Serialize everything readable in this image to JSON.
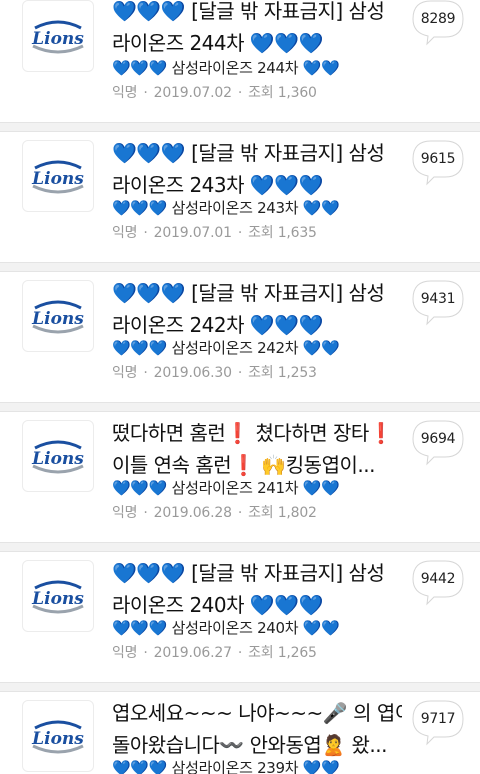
{
  "posts": [
    {
      "title_line1": "💙💙💙 [달글 밖 자표금지] 삼성",
      "title_line2": "라이온즈 244차 💙💙💙",
      "preview": "💙💙💙 삼성라이온즈 244차 💙💙",
      "author": "익명",
      "date": "2019.07.02",
      "views": "조회 1,360",
      "comments": "8289"
    },
    {
      "title_line1": "💙💙💙 [달글 밖 자표금지] 삼성",
      "title_line2": "라이온즈 243차 💙💙💙",
      "preview": "💙💙💙 삼성라이온즈 243차 💙💙",
      "author": "익명",
      "date": "2019.07.01",
      "views": "조회 1,635",
      "comments": "9615"
    },
    {
      "title_line1": "💙💙💙 [달글 밖 자표금지] 삼성",
      "title_line2": "라이온즈 242차 💙💙💙",
      "preview": "💙💙💙 삼성라이온즈 242차 💙💙",
      "author": "익명",
      "date": "2019.06.30",
      "views": "조회 1,253",
      "comments": "9431"
    },
    {
      "title_line1": "떴다하면 홈런❗ 쳤다하면 장타❗",
      "title_line2": "이틀 연속 홈런❗ 🙌킹동엽이...",
      "preview": "💙💙💙 삼성라이온즈 241차 💙💙",
      "author": "익명",
      "date": "2019.06.28",
      "views": "조회 1,802",
      "comments": "9694"
    },
    {
      "title_line1": "💙💙💙 [달글 밖 자표금지] 삼성",
      "title_line2": "라이온즈 240차 💙💙💙",
      "preview": "💙💙💙 삼성라이온즈 240차 💙💙",
      "author": "익명",
      "date": "2019.06.27",
      "views": "조회 1,265",
      "comments": "9442"
    },
    {
      "title_line1": "엽오세요~~~ 나야~~~🎤 의 엽이",
      "title_line2": "돌아왔습니다〰️ 안와동엽🙎 왔...",
      "preview": "💙💙💙 삼성라이온즈 239차 💙💙",
      "author": "익명",
      "date": "",
      "views": "",
      "comments": "9717"
    }
  ],
  "logo": {
    "text": "Lions",
    "arc_text": "SAMSUNG",
    "color": "#1a4fa0"
  }
}
